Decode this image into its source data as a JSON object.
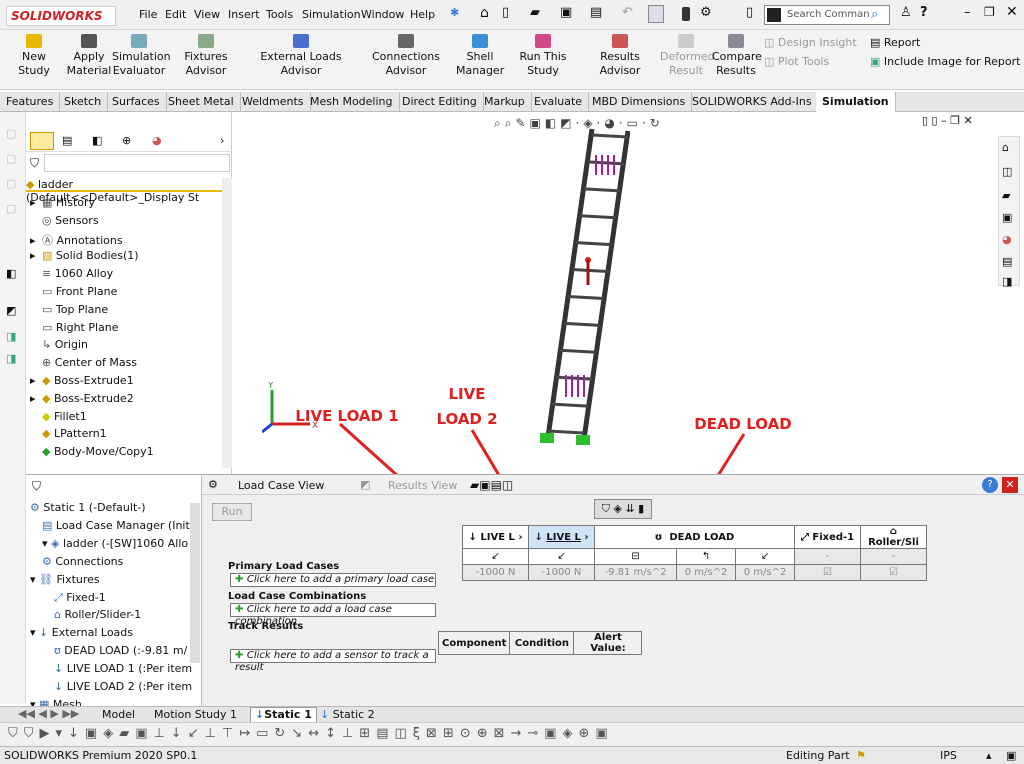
{
  "titlebar": {
    "logo": "SOLIDWORKS",
    "menus": [
      "File",
      "Edit",
      "View",
      "Insert",
      "Tools",
      "Simulation",
      "Window",
      "Help"
    ],
    "search_placeholder": "Search Comman"
  },
  "commands": [
    {
      "label": "New Study"
    },
    {
      "label": "Apply Material"
    },
    {
      "label": "Simulation Evaluator"
    },
    {
      "label": "Fixtures Advisor"
    },
    {
      "label": "External Loads Advisor"
    },
    {
      "label": "Connections Advisor"
    },
    {
      "label": "Shell Manager"
    },
    {
      "label": "Run This Study"
    },
    {
      "label": "Results Advisor"
    },
    {
      "label": "Deformed Result"
    },
    {
      "label": "Compare Results"
    },
    {
      "label": "Design Insight"
    },
    {
      "label": "Plot Tools"
    },
    {
      "label": "Report"
    },
    {
      "label": "Include Image for Report"
    }
  ],
  "tabs": [
    "Features",
    "Sketch",
    "Surfaces",
    "Sheet Metal",
    "Weldments",
    "Mesh Modeling",
    "Direct Editing",
    "Markup",
    "Evaluate",
    "MBD Dimensions",
    "SOLIDWORKS Add-Ins",
    "Simulation"
  ],
  "feature_tree": {
    "root": "ladder  (Default<<Default>_Display St",
    "items": [
      "History",
      "Sensors",
      "Annotations",
      "Solid Bodies(1)",
      "1060 Alloy",
      "Front Plane",
      "Top Plane",
      "Right Plane",
      "Origin",
      "Center of Mass",
      "Boss-Extrude1",
      "Boss-Extrude2",
      "Fillet1",
      "LPattern1",
      "Body-Move/Copy1"
    ]
  },
  "annotations": {
    "live1": "LIVE LOAD 1",
    "live2_line1": "LIVE",
    "live2_line2": "LOAD 2",
    "dead": "DEAD LOAD"
  },
  "study_tree": {
    "items": [
      "Static 1 (-Default-)",
      "Load Case Manager (Initia",
      "ladder (-[SW]1060 Allo",
      "Connections",
      "Fixtures",
      "Fixed-1",
      "Roller/Slider-1",
      "External Loads",
      "DEAD LOAD (:-9.81 m/",
      "LIVE LOAD 1 (:Per item",
      "LIVE LOAD 2 (:Per item",
      "Mesh"
    ]
  },
  "load_case": {
    "tab_active": "Load Case View",
    "tab_inactive": "Results View",
    "run": "Run",
    "headers": [
      "LIVE L",
      "LIVE L",
      "DEAD LOAD",
      "Fixed-1",
      "Roller/Sli"
    ],
    "values": [
      "-1000 N",
      "-1000 N",
      "-9.81 m/s^2",
      "0 m/s^2",
      "0 m/s^2"
    ],
    "dash1": "-",
    "dash2": "-",
    "primary": "Primary Load Cases",
    "primary_add": "Click here to add a primary load case",
    "combos": "Load Case Combinations",
    "combos_add": "Click here to add a load case combination",
    "track": "Track Results",
    "track_cols": [
      "Component",
      "Condition",
      "Alert Value:"
    ],
    "track_add": "Click here to add a sensor to track a result"
  },
  "bottom_tabs": [
    "Model",
    "Motion Study 1",
    "Static 1",
    "Static 2"
  ],
  "status": {
    "left": "SOLIDWORKS Premium 2020 SP0.1",
    "mode": "Editing Part",
    "units": "IPS"
  }
}
